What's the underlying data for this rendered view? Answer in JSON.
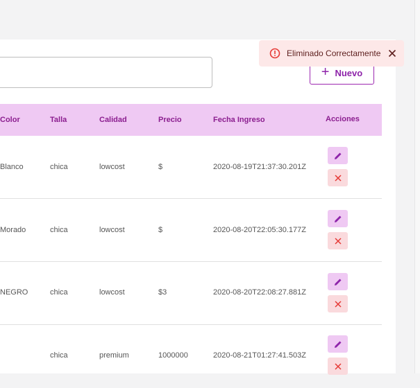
{
  "toolbar": {
    "search_value": "",
    "new_button_label": "Nuevo",
    "new_button_icon": "plus-icon"
  },
  "toast": {
    "message": "Eliminado Correctamente",
    "icon": "error-outline-icon",
    "close_icon": "close-icon",
    "background": "#fde8e8"
  },
  "table": {
    "headers": {
      "color": "Color",
      "talla": "Talla",
      "calidad": "Calidad",
      "precio": "Precio",
      "fecha": "Fecha Ingreso",
      "acciones": "Acciones"
    },
    "rows": [
      {
        "color": "Blanco",
        "talla": "chica",
        "calidad": "lowcost",
        "precio": "$",
        "fecha": "2020-08-19T21:37:30.201Z"
      },
      {
        "color": "Morado",
        "talla": "chica",
        "calidad": "lowcost",
        "precio": "$",
        "fecha": "2020-08-20T22:05:30.177Z"
      },
      {
        "color": "NEGRO",
        "talla": "chica",
        "calidad": "lowcost",
        "precio": "$3",
        "fecha": "2020-08-20T22:08:27.881Z"
      },
      {
        "color": "",
        "talla": "chica",
        "calidad": "premium",
        "precio": "1000000",
        "fecha": "2020-08-21T01:27:41.503Z"
      }
    ],
    "edit_icon": "pencil-icon",
    "delete_icon": "close-icon"
  },
  "colors": {
    "accent": "#8e24aa",
    "header_bg": "#efc9f3",
    "delete_bg": "#fadadd",
    "delete_icon": "#e53935"
  }
}
